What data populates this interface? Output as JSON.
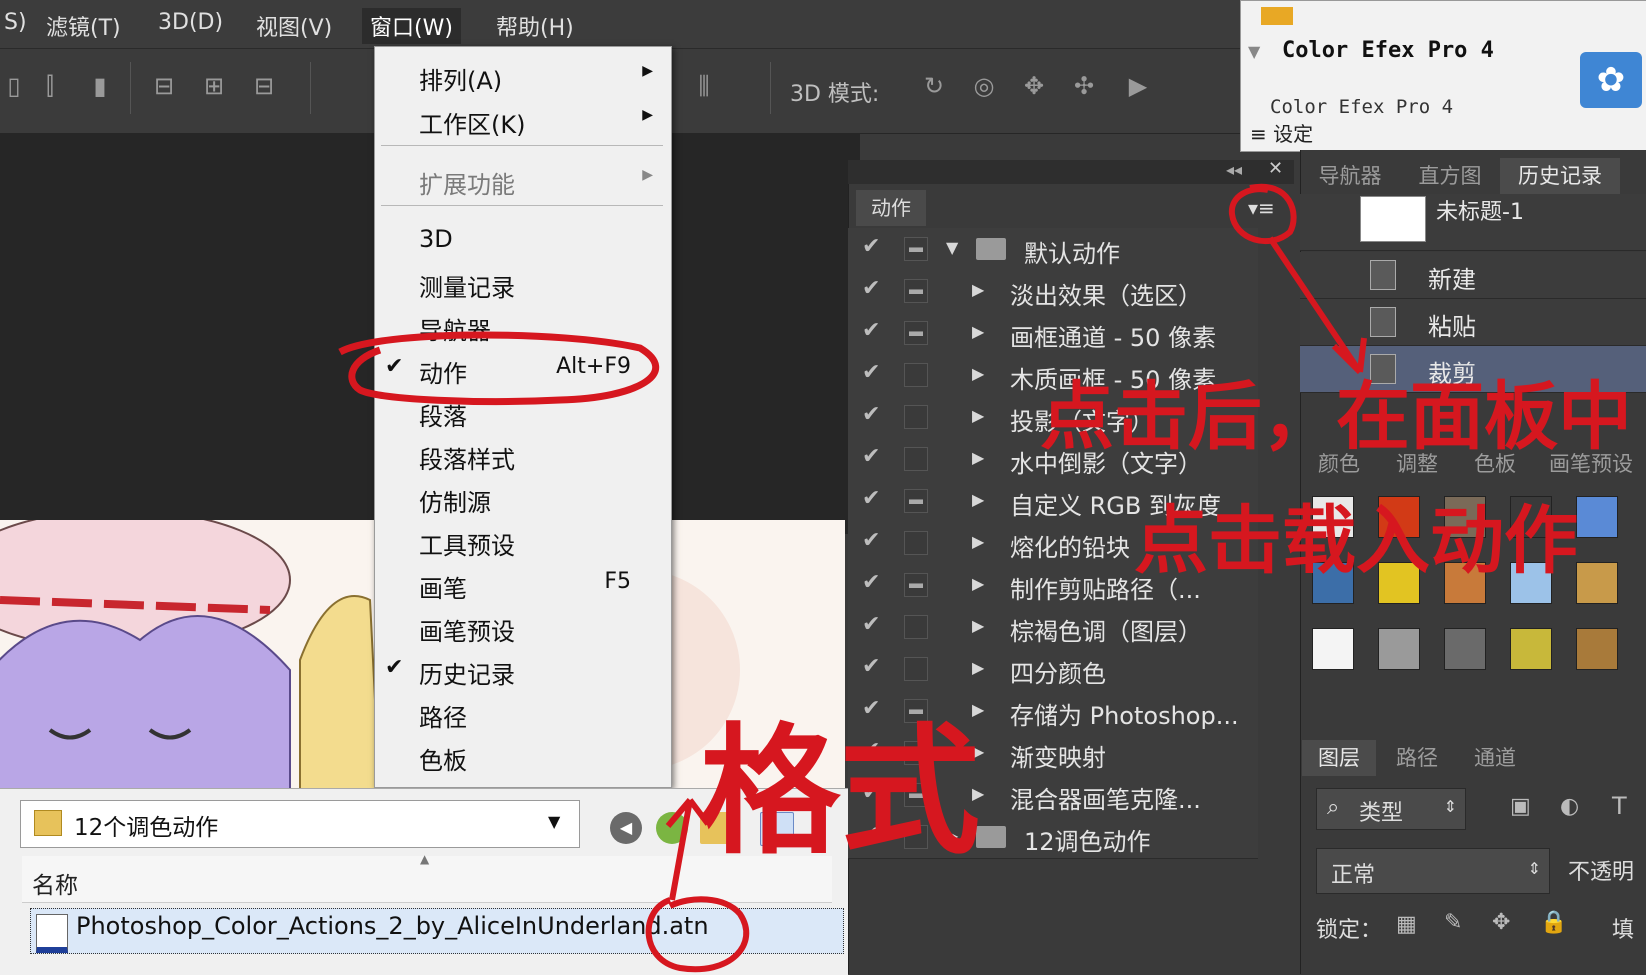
{
  "menubar": {
    "items": [
      "S)",
      "滤镜(T)",
      "3D(D)",
      "视图(V)",
      "窗口(W)",
      "帮助(H)"
    ],
    "active_index": 4
  },
  "options_bar": {
    "mode_label": "3D 模式:"
  },
  "window_menu": {
    "items": [
      {
        "label": "排列(A)",
        "submenu": true
      },
      {
        "label": "工作区(K)",
        "submenu": true
      },
      {
        "label": "扩展功能",
        "submenu": true,
        "disabled": true
      },
      {
        "label": "3D"
      },
      {
        "label": "测量记录"
      },
      {
        "label": "导航器"
      },
      {
        "label": "动作",
        "shortcut": "Alt+F9",
        "checked": true
      },
      {
        "label": "段落"
      },
      {
        "label": "段落样式"
      },
      {
        "label": "仿制源"
      },
      {
        "label": "工具预设"
      },
      {
        "label": "画笔",
        "shortcut": "F5"
      },
      {
        "label": "画笔预设"
      },
      {
        "label": "历史记录",
        "checked": true
      },
      {
        "label": "路径"
      },
      {
        "label": "色板"
      }
    ]
  },
  "actions_panel": {
    "tab": "动作",
    "rows": [
      {
        "label": "默认动作",
        "type": "set",
        "expanded": true,
        "dialog": true
      },
      {
        "label": "淡出效果（选区）",
        "dialog": true
      },
      {
        "label": "画框通道 - 50 像素",
        "dialog": true
      },
      {
        "label": "木质画框 - 50 像素",
        "dialog": false
      },
      {
        "label": "投影（文字）",
        "dialog": false
      },
      {
        "label": "水中倒影（文字）",
        "dialog": false
      },
      {
        "label": "自定义 RGB 到灰度",
        "dialog": true
      },
      {
        "label": "熔化的铅块",
        "dialog": false
      },
      {
        "label": "制作剪贴路径（...",
        "dialog": true
      },
      {
        "label": "棕褐色调（图层）",
        "dialog": false
      },
      {
        "label": "四分颜色",
        "dialog": false
      },
      {
        "label": "存储为 Photoshop...",
        "dialog": true
      },
      {
        "label": "渐变映射",
        "dialog": false
      },
      {
        "label": "混合器画笔克隆...",
        "dialog": true
      },
      {
        "label": "12调色动作",
        "type": "set",
        "expanded": false,
        "dialog": false
      }
    ]
  },
  "color_efex": {
    "title": "Color Efex Pro 4",
    "subtitle": "Color Efex Pro 4",
    "settings": "设定"
  },
  "right_panels": {
    "top_tabs": [
      "导航器",
      "直方图",
      "历史记录"
    ],
    "history_doc": "未标题-1",
    "history_items": [
      "新建",
      "粘贴",
      "裁剪"
    ],
    "mid_tabs": [
      "颜色",
      "调整",
      "色板",
      "画笔预设"
    ],
    "layer_tabs": [
      "图层",
      "路径",
      "通道"
    ],
    "filter_label": "类型",
    "blend_mode": "正常",
    "opacity_label": "不透明",
    "lock_label": "锁定：",
    "fill_label": "填"
  },
  "file_dialog": {
    "folder": "12个调色动作",
    "column_header": "名称",
    "file": "Photoshop_Color_Actions_2_by_AliceInUnderland.atn"
  },
  "annotations": {
    "line1": "点击后，在面板中",
    "line2": "点击载入动作",
    "handwritten": "格式"
  },
  "colors": {
    "annotation_red": "#d6171f",
    "panel_bg": "#3a3a3a",
    "menu_bg": "#f0f0f0",
    "selection_blue": "#dbe8f8"
  }
}
